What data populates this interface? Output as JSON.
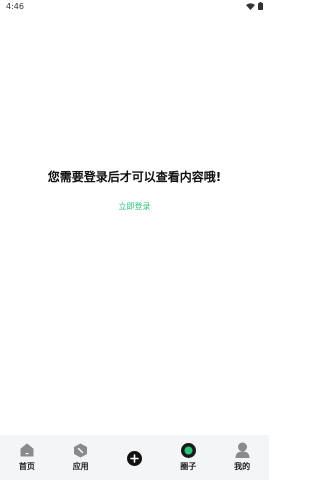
{
  "status_bar": {
    "time": "4:46"
  },
  "main": {
    "message": "您需要登录后才可以查看内容哦!",
    "login_link": "立即登录"
  },
  "bottom_nav": {
    "items": [
      {
        "label": "首页",
        "icon": "home-icon"
      },
      {
        "label": "应用",
        "icon": "apps-icon"
      },
      {
        "label": "",
        "icon": "add-icon"
      },
      {
        "label": "圈子",
        "icon": "circle-icon"
      },
      {
        "label": "我的",
        "icon": "profile-icon"
      }
    ]
  },
  "colors": {
    "accent": "#2ac37a",
    "nav_background": "#f4f5f7",
    "icon_gray": "#8a8a8a",
    "text_dark": "#111111"
  }
}
